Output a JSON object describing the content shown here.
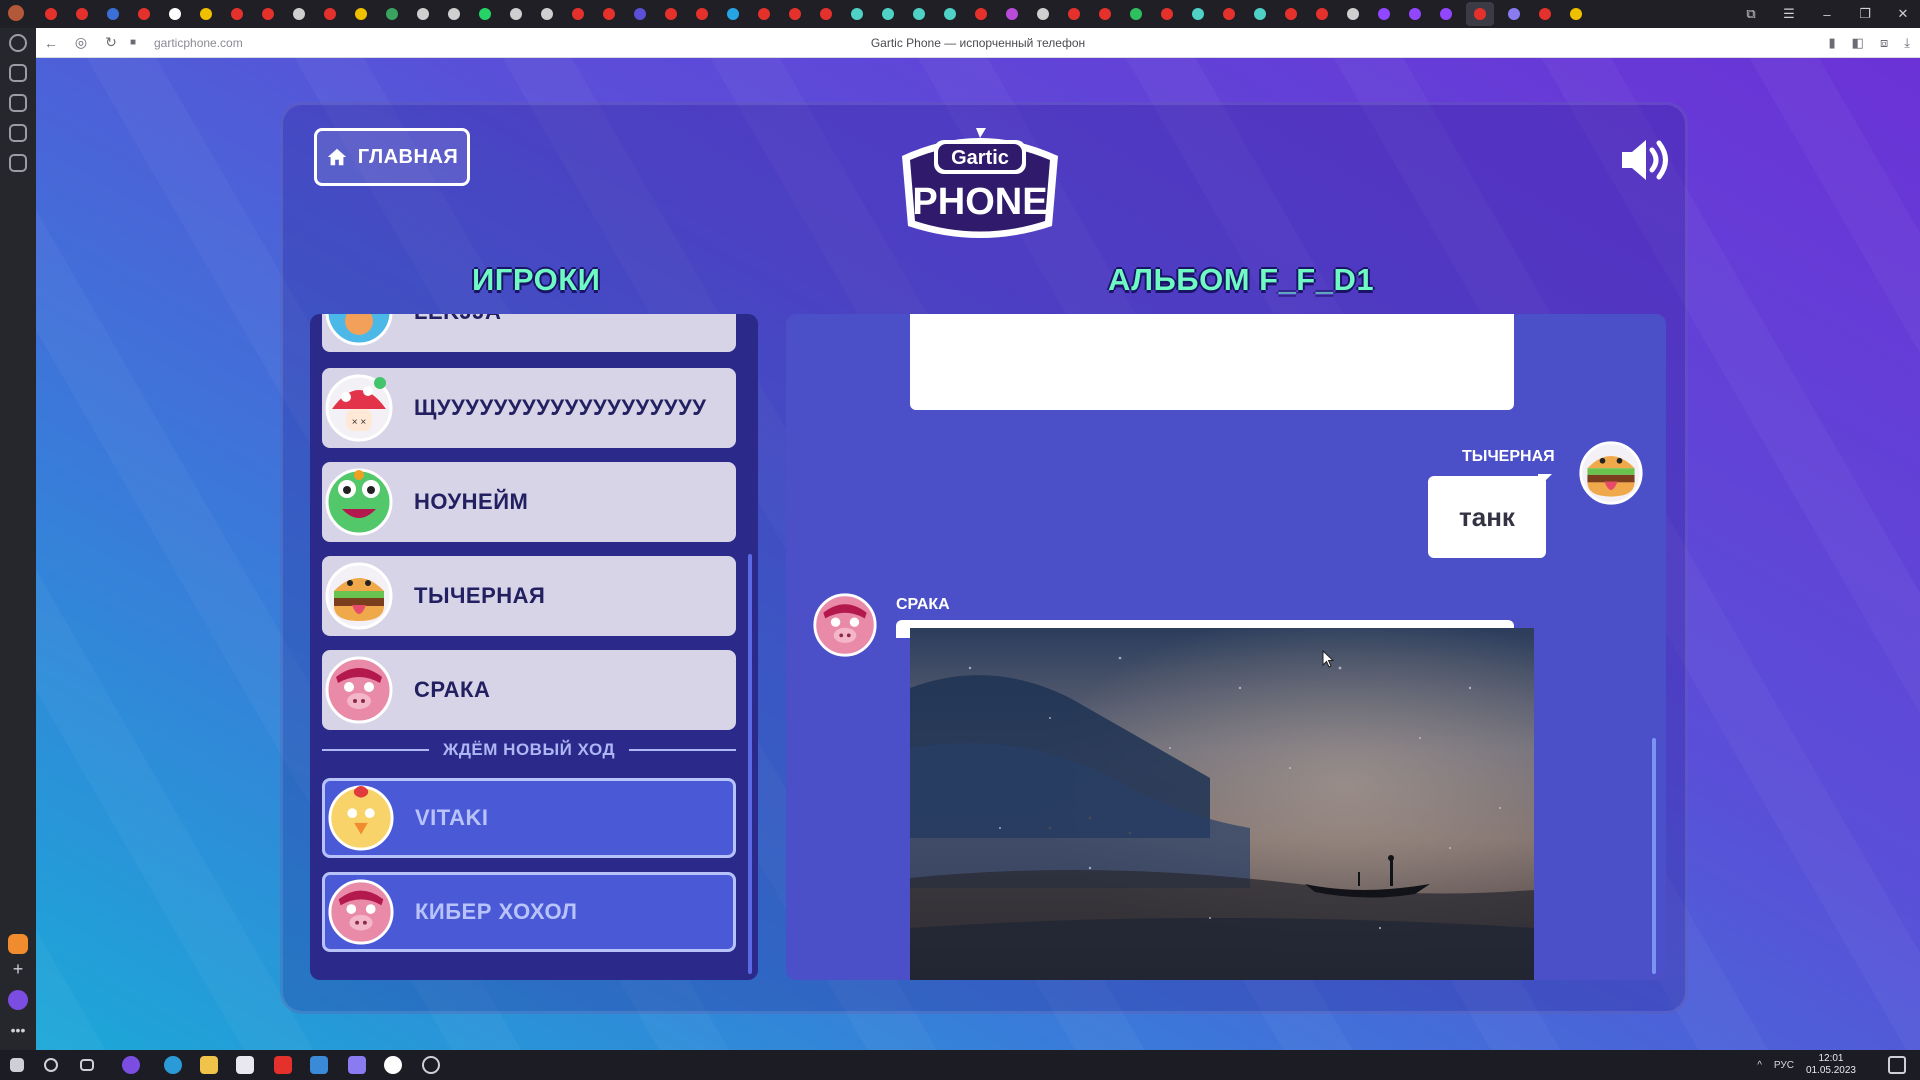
{
  "browser": {
    "url": "garticphone.com",
    "page_title": "Gartic Phone — испорченный телефон",
    "nav_icons": [
      "back-icon",
      "shield-icon",
      "reload-icon",
      "lock-icon"
    ],
    "right_icons": [
      "bookmark-icon",
      "extension-icon",
      "reading-icon",
      "download-icon"
    ],
    "tab_favicon_colors": [
      "#e4312b",
      "#e4312b",
      "#3b6fd6",
      "#e4312b",
      "#ffffff",
      "#f0c000",
      "#e4312b",
      "#e4312b",
      "#cfcfcf",
      "#e4312b",
      "#f0c000",
      "#3aa360",
      "#cfcfcf",
      "#cfcfcf",
      "#25d366",
      "#cfcfcf",
      "#cfcfcf",
      "#e4312b",
      "#e4312b",
      "#5b4fd6",
      "#e4312b",
      "#e4312b",
      "#26a5e4",
      "#e4312b",
      "#e4312b",
      "#e4312b",
      "#4fd1c5",
      "#4fd1c5",
      "#4fd1c5",
      "#4fd1c5",
      "#e4312b",
      "#b84bd8",
      "#cfcfcf",
      "#e4312b",
      "#e4312b",
      "#2fbf5f",
      "#e4312b",
      "#4fd1c5",
      "#e4312b",
      "#4fd1c5",
      "#e4312b",
      "#e4312b",
      "#cfcfcf",
      "#9146ff",
      "#9146ff",
      "#9146ff",
      "#e4312b",
      "#8a7cf0",
      "#e4312b",
      "#f0c000"
    ],
    "window_controls": [
      "⧉",
      "☰",
      "–",
      "❐",
      "✕"
    ]
  },
  "game": {
    "home_label": "ГЛАВНАЯ",
    "logo_top": "Gartic",
    "logo_bottom": "PHONE",
    "players_title": "ИГРОКИ",
    "album_title": "АЛЬБОМ F_F_D1",
    "players": [
      {
        "name": "LEKJJA",
        "avatar": "blue-creature-avatar"
      },
      {
        "name": "ЩУУУУУУУУУУУУУУУУУУУ",
        "avatar": "mushroom-avatar"
      },
      {
        "name": "НОУНЕЙМ",
        "avatar": "frog-avatar"
      },
      {
        "name": "ТЫЧЕРНАЯ",
        "avatar": "burger-avatar"
      },
      {
        "name": "СРАКА",
        "avatar": "pig-avatar"
      }
    ],
    "waiting_label": "ЖДЁМ НОВЫЙ ХОД",
    "waiting_players": [
      {
        "name": "VITAKI",
        "avatar": "chicken-avatar"
      },
      {
        "name": "КИБЕР ХОХОЛ",
        "avatar": "pig-avatar"
      }
    ],
    "album": {
      "message_author": "ТЫЧЕРНАЯ",
      "message_text": "танк",
      "drawing_author": "СРАКА",
      "drawing_content": "night-sea-boat-drawing"
    }
  },
  "taskbar": {
    "lang": "РУС",
    "time": "12:01",
    "date": "01.05.2023"
  }
}
